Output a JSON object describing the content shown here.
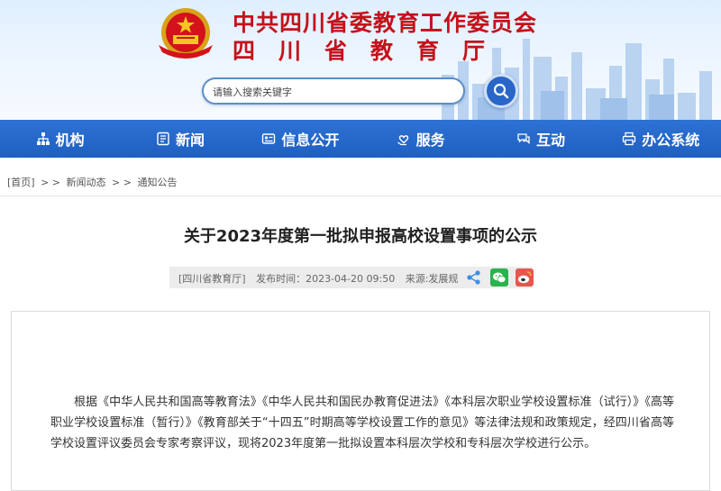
{
  "header": {
    "org_name": "中共四川省委教育工作委员会",
    "dept_name": "四川省教育厅",
    "search": {
      "placeholder": "请输入搜索关键字"
    },
    "emblem_icon": "national-emblem-icon",
    "search_icon": "magnifier-icon"
  },
  "nav": {
    "items": [
      {
        "label": "机构",
        "icon": "org-tree-icon"
      },
      {
        "label": "新闻",
        "icon": "newspaper-icon"
      },
      {
        "label": "信息公开",
        "icon": "info-card-icon"
      },
      {
        "label": "服务",
        "icon": "hand-heart-icon"
      },
      {
        "label": "互动",
        "icon": "chat-icon"
      },
      {
        "label": "办公系统",
        "icon": "printer-icon"
      }
    ]
  },
  "breadcrumb": {
    "home": "[首页]",
    "sep": "> >",
    "level1": "新闻动态",
    "level2": "通知公告"
  },
  "article": {
    "title": "关于2023年度第一批拟申报高校设置事项的公示",
    "source_site": "[四川省教育厅]",
    "publish_time": "发布时间：2023-04-20 09:50",
    "origin": "来源:发展规",
    "paragraph": "根据《中华人民共和国高等教育法》《中华人民共和国民办教育促进法》《本科层次职业学校设置标准（试行）》《高等职业学校设置标准（暂行）》《教育部关于“十四五”时期高等学校设置工作的意见》等法律法规和政策规定，经四川省高等学校设置评议委员会专家考察评议，现将2023年度第一批拟设置本科层次学校和专科层次学校进行公示。"
  },
  "colors": {
    "brand_red": "#c4111b",
    "nav_blue": "#2d72d4",
    "wechat_green": "#2bb24c",
    "weibo_red": "#e8554e"
  }
}
